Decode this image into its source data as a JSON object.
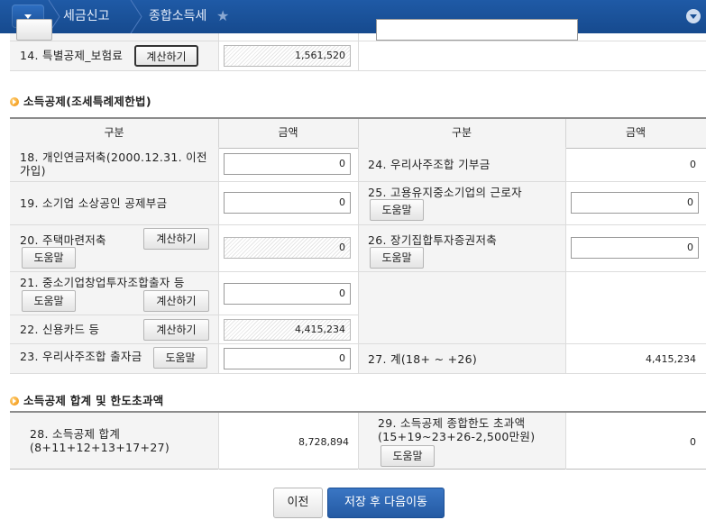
{
  "topbar": {
    "breadcrumb": [
      "세금신고",
      "종합소득세"
    ]
  },
  "row14": {
    "label": "14. 특별공제_보험료",
    "calc_button": "계산하기",
    "value": "1,561,520"
  },
  "section_income_deduction": {
    "title": "소득공제(조세특례제한법)",
    "headers": {
      "category": "구분",
      "amount": "금액"
    },
    "left": [
      {
        "label": "18. 개인연금저축(2000.12.31. 이전가입)",
        "value": "0"
      },
      {
        "label": "19. 소기업 소상공인 공제부금",
        "value": "0"
      },
      {
        "label": "20. 주택마련저축",
        "calc_button": "계산하기",
        "help_button": "도움말",
        "value": "0"
      },
      {
        "label": "21. 중소기업창업투자조합출자 등",
        "help_button": "도움말",
        "calc_button": "계산하기",
        "value": "0"
      },
      {
        "label": "22. 신용카드 등",
        "calc_button": "계산하기",
        "value": "4,415,234"
      },
      {
        "label": "23. 우리사주조합 출자금",
        "help_button": "도움말",
        "value": "0"
      }
    ],
    "right": [
      {
        "label": "24. 우리사주조합 기부금",
        "value": "0"
      },
      {
        "label": "25. 고용유지중소기업의 근로자",
        "help_button": "도움말",
        "value": "0"
      },
      {
        "label": "26. 장기집합투자증권저축",
        "help_button": "도움말",
        "value": "0"
      },
      {
        "label": "27. 계(18+ ~ +26)",
        "value": "4,415,234"
      }
    ]
  },
  "section_total": {
    "title": "소득공제 합계 및 한도초과액",
    "row28": {
      "label": "28. 소득공제 합계(8+11+12+13+17+27)",
      "value": "8,728,894"
    },
    "row29": {
      "label": "29. 소득공제 종합한도 초과액(15+19~23+26-2,500만원)",
      "help_button": "도움말",
      "value": "0"
    }
  },
  "footer": {
    "prev_button": "이전",
    "save_next_button": "저장 후 다음이동"
  },
  "colors": {
    "topbar": "#1a4f94",
    "primary_button": "#2a63b0",
    "section_bullet": "#f08c00"
  }
}
